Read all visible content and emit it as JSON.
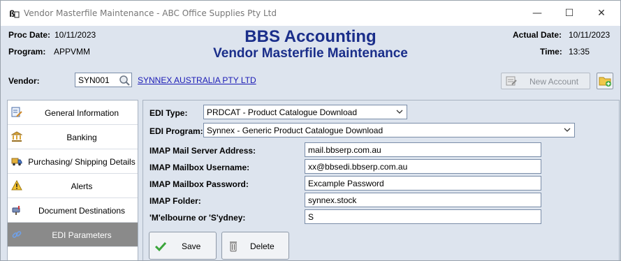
{
  "window": {
    "title": "Vendor Masterfile Maintenance - ABC Office Supplies Pty Ltd",
    "app_icon": "app-logo-icon",
    "controls": {
      "minimize": "—",
      "maximize": "☐",
      "close": "✕"
    }
  },
  "header": {
    "proc_date_label": "Proc Date:",
    "proc_date_value": "10/11/2023",
    "program_label": "Program:",
    "program_value": "APPVMM",
    "title": "BBS Accounting",
    "subtitle": "Vendor Masterfile Maintenance",
    "actual_date_label": "Actual Date:",
    "actual_date_value": "10/11/2023",
    "time_label": "Time:",
    "time_value": "13:35"
  },
  "vendor": {
    "label": "Vendor:",
    "code": "SYN001",
    "name": "SYNNEX AUSTRALIA PTY LTD",
    "new_account_label": "New Account"
  },
  "sidebar": {
    "items": [
      {
        "label": "General Information",
        "icon": "document-pen-icon",
        "active": false
      },
      {
        "label": "Banking",
        "icon": "bank-icon",
        "active": false
      },
      {
        "label": "Purchasing/ Shipping Details",
        "icon": "truck-icon",
        "active": false
      },
      {
        "label": "Alerts",
        "icon": "warning-icon",
        "active": false
      },
      {
        "label": "Document Destinations",
        "icon": "mailbox-icon",
        "active": false
      },
      {
        "label": "EDI Parameters",
        "icon": "link-icon",
        "active": true
      }
    ]
  },
  "edi": {
    "type_label": "EDI Type:",
    "type_value": "PRDCAT - Product Catalogue Download",
    "program_label": "EDI Program:",
    "program_value": "Synnex - Generic Product Catalogue Download",
    "server_label": "IMAP Mail Server Address:",
    "server_value": "mail.bbserp.com.au",
    "username_label": "IMAP Mailbox Username:",
    "username_value": "xx@bbsedi.bbserp.com.au",
    "password_label": "IMAP Mailbox Password:",
    "password_value": "Excample Password",
    "folder_label": "IMAP Folder:",
    "folder_value": "synnex.stock",
    "region_label": "'M'elbourne or 'S'ydney:",
    "region_value": "S"
  },
  "actions": {
    "save_label": "Save",
    "delete_label": "Delete"
  },
  "colors": {
    "title_blue": "#1a2e8a",
    "link_blue": "#1a1ab5",
    "panel_bg": "#dde4ee",
    "active_item_bg": "#8a8a8a"
  }
}
